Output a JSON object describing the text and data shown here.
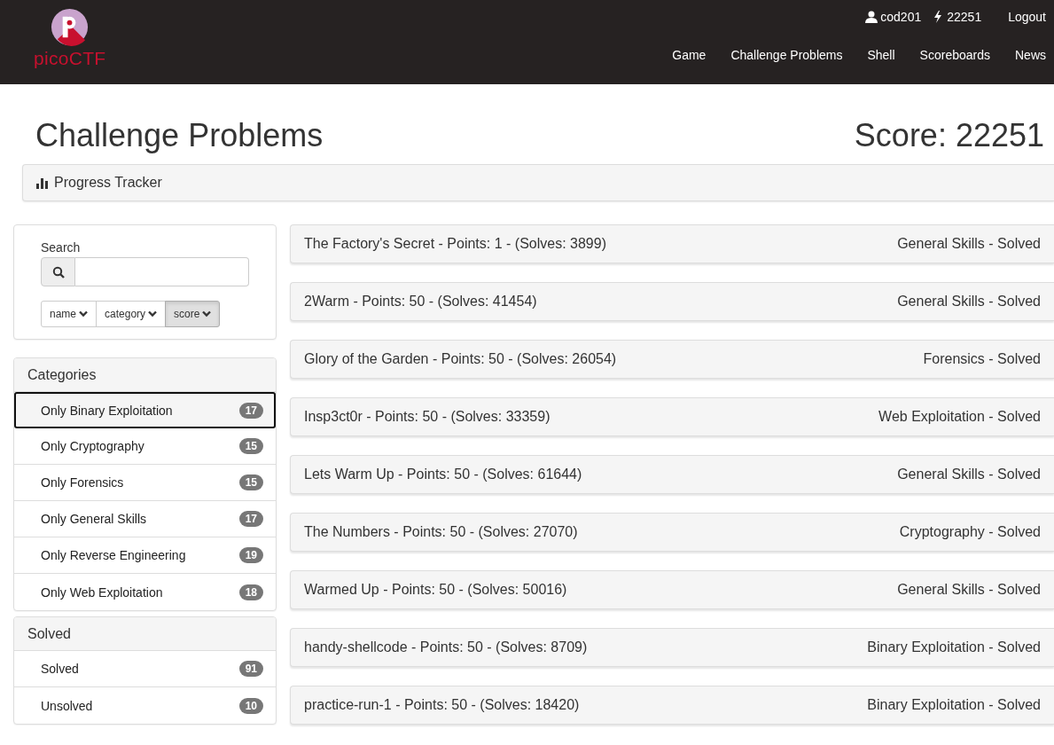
{
  "brand": {
    "name": "picoCTF"
  },
  "user": {
    "username": "cod201",
    "score": "22251",
    "logout": "Logout"
  },
  "nav": [
    {
      "label": "Game"
    },
    {
      "label": "Challenge Problems"
    },
    {
      "label": "Shell"
    },
    {
      "label": "Scoreboards"
    },
    {
      "label": "News"
    }
  ],
  "page": {
    "title": "Challenge Problems",
    "score": "Score: 22251"
  },
  "progress_tracker": {
    "label": "Progress Tracker"
  },
  "search": {
    "label": "Search"
  },
  "sort_buttons": [
    {
      "label": "name",
      "selected": false
    },
    {
      "label": "category",
      "selected": false
    },
    {
      "label": "score",
      "selected": true
    }
  ],
  "filter_groups": [
    {
      "title": "Categories",
      "items": [
        {
          "label": "Only Binary Exploitation",
          "count": "17",
          "selected": true
        },
        {
          "label": "Only Cryptography",
          "count": "15",
          "selected": false
        },
        {
          "label": "Only Forensics",
          "count": "15",
          "selected": false
        },
        {
          "label": "Only General Skills",
          "count": "17",
          "selected": false
        },
        {
          "label": "Only Reverse Engineering",
          "count": "19",
          "selected": false
        },
        {
          "label": "Only Web Exploitation",
          "count": "18",
          "selected": false
        }
      ]
    },
    {
      "title": "Solved",
      "items": [
        {
          "label": "Solved",
          "count": "91",
          "selected": false
        },
        {
          "label": "Unsolved",
          "count": "10",
          "selected": false
        }
      ]
    }
  ],
  "problems": [
    {
      "title": "The Factory's Secret - Points: 1 - (Solves: 3899)",
      "status": "General Skills - Solved"
    },
    {
      "title": "2Warm - Points: 50 - (Solves: 41454)",
      "status": "General Skills - Solved"
    },
    {
      "title": "Glory of the Garden - Points: 50 - (Solves: 26054)",
      "status": "Forensics - Solved"
    },
    {
      "title": "Insp3ct0r - Points: 50 - (Solves: 33359)",
      "status": "Web Exploitation - Solved"
    },
    {
      "title": "Lets Warm Up - Points: 50 - (Solves: 61644)",
      "status": "General Skills - Solved"
    },
    {
      "title": "The Numbers - Points: 50 - (Solves: 27070)",
      "status": "Cryptography - Solved"
    },
    {
      "title": "Warmed Up - Points: 50 - (Solves: 50016)",
      "status": "General Skills - Solved"
    },
    {
      "title": "handy-shellcode - Points: 50 - (Solves: 8709)",
      "status": "Binary Exploitation - Solved"
    },
    {
      "title": "practice-run-1 - Points: 50 - (Solves: 18420)",
      "status": "Binary Exploitation - Solved"
    }
  ]
}
